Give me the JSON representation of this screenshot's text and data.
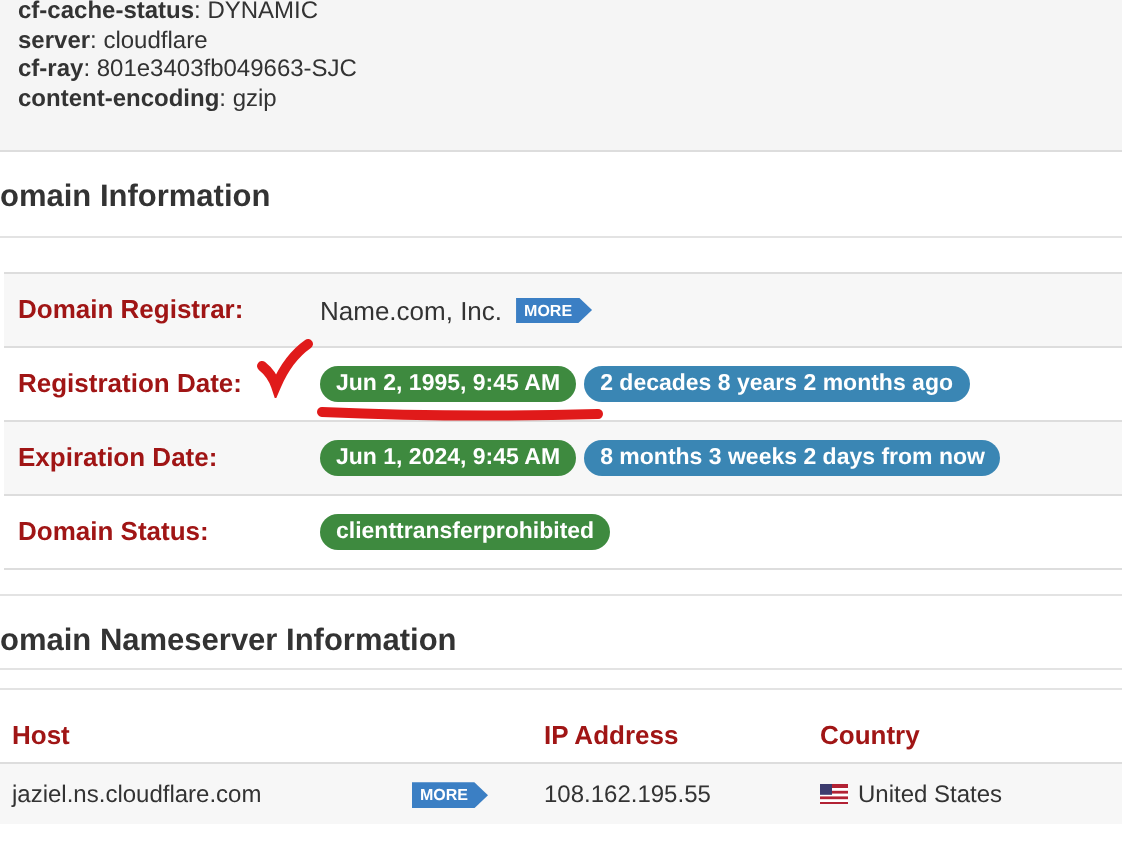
{
  "headers": [
    {
      "line": "**cf-cache-status**: DYNAMIC"
    },
    {
      "line": "**server**: cloudflare"
    },
    {
      "line": "**cf-ray**: 801e3403fb049663-SJC"
    },
    {
      "line": "**content-encoding**: gzip"
    }
  ],
  "domain_info": {
    "title": "omain Information",
    "rows": [
      {
        "label": "Domain Registrar:",
        "kind": "text",
        "value": "Name.com, Inc.",
        "more": "MORE"
      },
      {
        "label": "Registration Date:",
        "kind": "badges",
        "badges": [
          {
            "text": "Jun 2, 1995, 9:45 AM",
            "color": "#3e8a3f"
          },
          {
            "text": "2 decades 8 years 2 months ago",
            "color": "#3a86b4"
          }
        ]
      },
      {
        "label": "Expiration Date:",
        "kind": "badges",
        "badges": [
          {
            "text": "Jun 1, 2024, 9:45 AM",
            "color": "#3e8a3f"
          },
          {
            "text": "8 months 3 weeks 2 days from now",
            "color": "#3a86b4"
          }
        ]
      },
      {
        "label": "Domain Status:",
        "kind": "badges",
        "badges": [
          {
            "text": "clienttransferprohibited",
            "color": "#3e8a3f"
          }
        ]
      }
    ]
  },
  "nameservers": {
    "title": "omain Nameserver Information",
    "columns": [
      "Host",
      "IP Address",
      "Country"
    ],
    "rows": [
      {
        "host": "jaziel.ns.cloudflare.com",
        "more": "MORE",
        "ip": "108.162.195.55",
        "country": "United States"
      }
    ]
  }
}
